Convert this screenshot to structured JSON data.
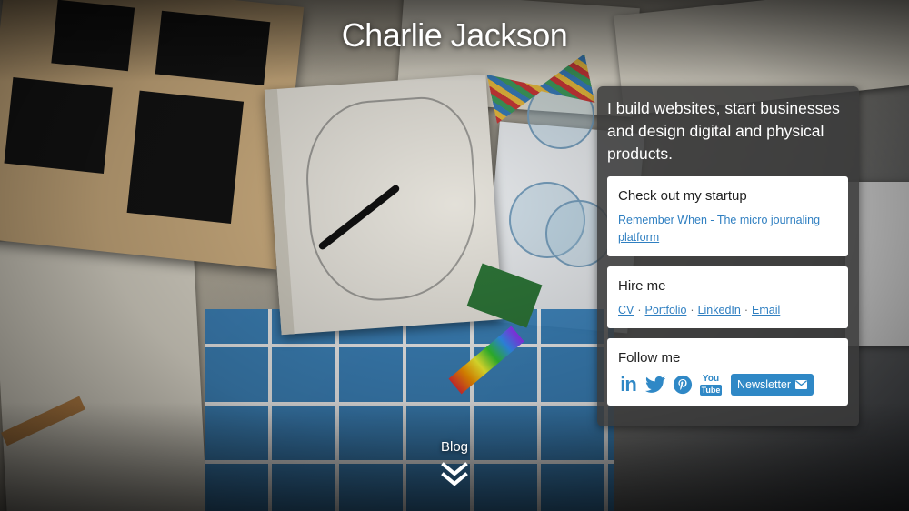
{
  "header": {
    "title": "Charlie Jackson"
  },
  "intro": {
    "text": "I build websites, start businesses and design digital and physical products."
  },
  "startup": {
    "heading": "Check out my startup",
    "link_label": "Remember When - The micro journaling platform"
  },
  "hire": {
    "heading": "Hire me",
    "links": [
      "CV",
      "Portfolio",
      "LinkedIn",
      "Email"
    ],
    "separator": "·"
  },
  "follow": {
    "heading": "Follow me",
    "icons": [
      "linkedin-icon",
      "twitter-icon",
      "pinterest-icon",
      "youtube-icon"
    ],
    "youtube_text_top": "You",
    "youtube_text_bottom": "Tube",
    "linkedin_text": "in",
    "newsletter_label": "Newsletter"
  },
  "blog": {
    "label": "Blog"
  },
  "colors": {
    "accent": "#2f88c6",
    "link": "#2f7fc1",
    "panel_bg": "rgba(58,58,58,0.86)"
  }
}
